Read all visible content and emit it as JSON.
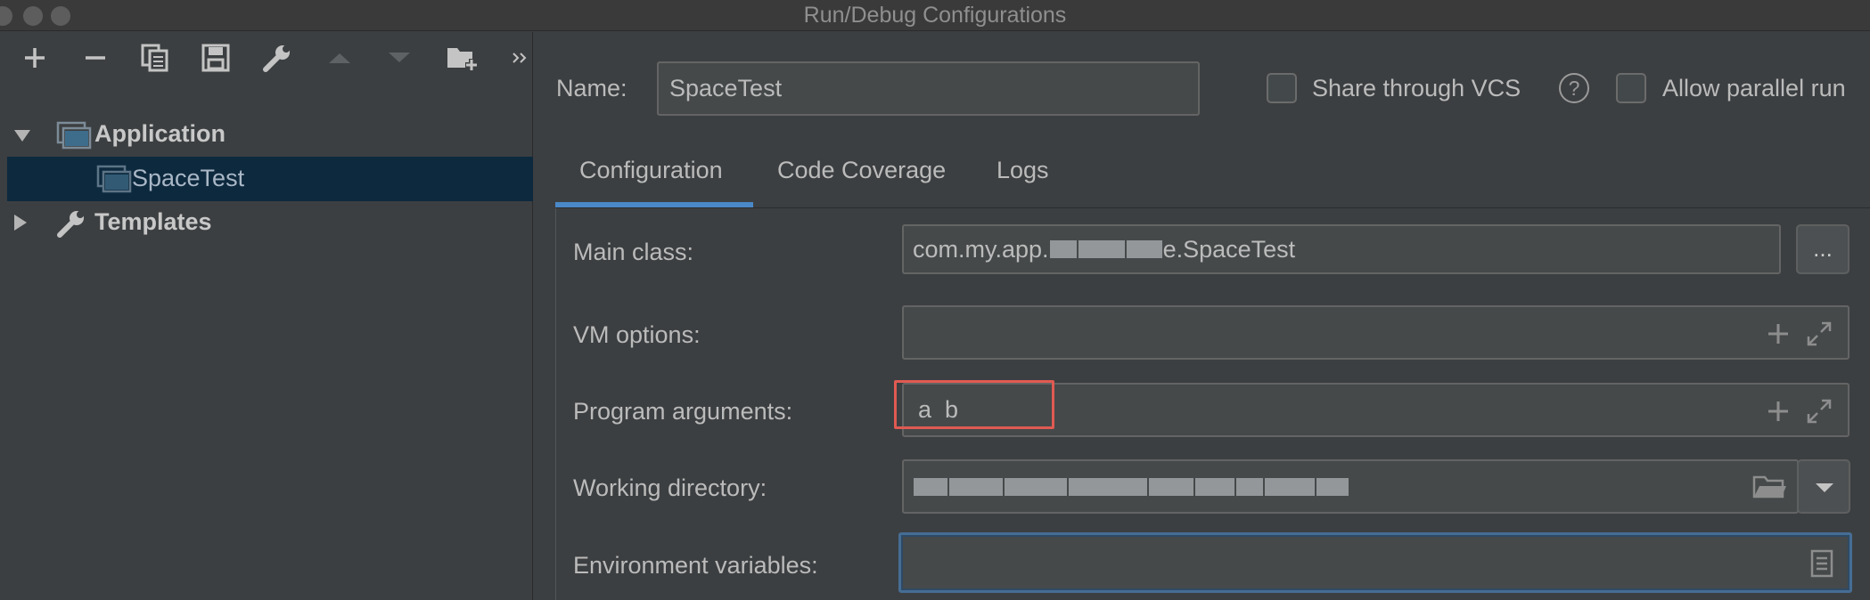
{
  "window": {
    "title": "Run/Debug Configurations"
  },
  "toolbar": {
    "icons": [
      "add-icon",
      "remove-icon",
      "copy-icon",
      "save-icon",
      "wrench-icon",
      "move-up-icon",
      "move-down-icon",
      "new-folder-icon",
      "more-icon"
    ]
  },
  "tree": {
    "application_label": "Application",
    "spacetest_label": "SpaceTest",
    "templates_label": "Templates"
  },
  "header": {
    "name_label": "Name:",
    "name_value": "SpaceTest",
    "share_label": "Share through VCS",
    "help_glyph": "?",
    "parallel_label": "Allow parallel run"
  },
  "tabs": [
    "Configuration",
    "Code Coverage",
    "Logs"
  ],
  "form": {
    "main_class_label": "Main class:",
    "main_class_prefix": "com.my.app.",
    "main_class_suffix": "e.SpaceTest",
    "browse_label": "...",
    "vm_options_label": "VM options:",
    "program_args_label": "Program arguments:",
    "program_args_value": "a  b",
    "working_dir_label": "Working directory:",
    "env_vars_label": "Environment variables:"
  },
  "colors": {
    "background": "#3c3f41",
    "selection": "#0d293e",
    "accent": "#4a88c7",
    "highlight_box": "#e05a52"
  }
}
